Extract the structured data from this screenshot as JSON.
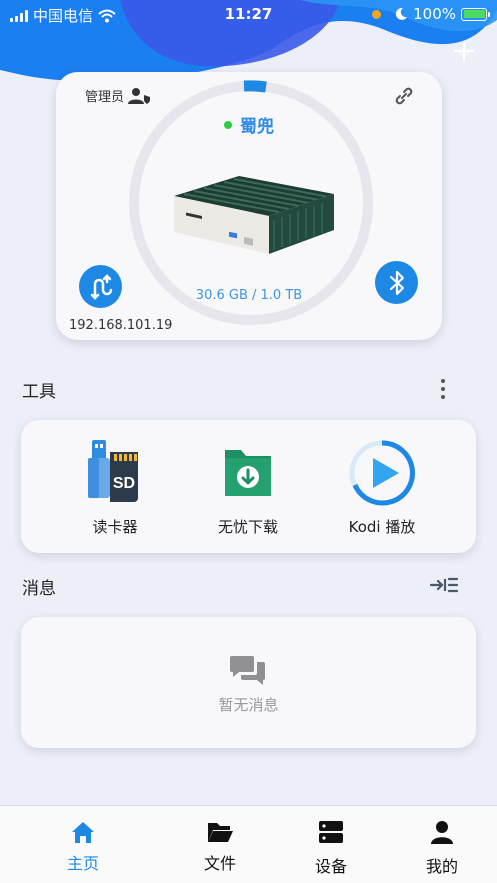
{
  "status_bar": {
    "carrier": "中国电信",
    "time": "11:27",
    "battery": "100%"
  },
  "device": {
    "role": "管理员",
    "name": "蜀兜",
    "storage": "30.6 GB / 1.0 TB",
    "storage_used_fraction": 0.03,
    "ip": "192.168.101.19",
    "online_color": "#2ecc40"
  },
  "tools": {
    "title": "工具",
    "items": [
      {
        "label": "读卡器",
        "icon": "sd-card-reader-icon"
      },
      {
        "label": "无忧下载",
        "icon": "download-folder-icon"
      },
      {
        "label": "Kodi 播放",
        "icon": "play-icon"
      }
    ]
  },
  "messages": {
    "title": "消息",
    "empty_text": "暂无消息"
  },
  "tab_bar": {
    "items": [
      {
        "label": "主页",
        "icon": "home-icon",
        "active": true
      },
      {
        "label": "文件",
        "icon": "folder-icon",
        "active": false
      },
      {
        "label": "设备",
        "icon": "server-icon",
        "active": false
      },
      {
        "label": "我的",
        "icon": "person-icon",
        "active": false
      }
    ]
  },
  "colors": {
    "accent": "#1e88e5",
    "background": "#eceef8",
    "card": "#f8f8fb"
  }
}
